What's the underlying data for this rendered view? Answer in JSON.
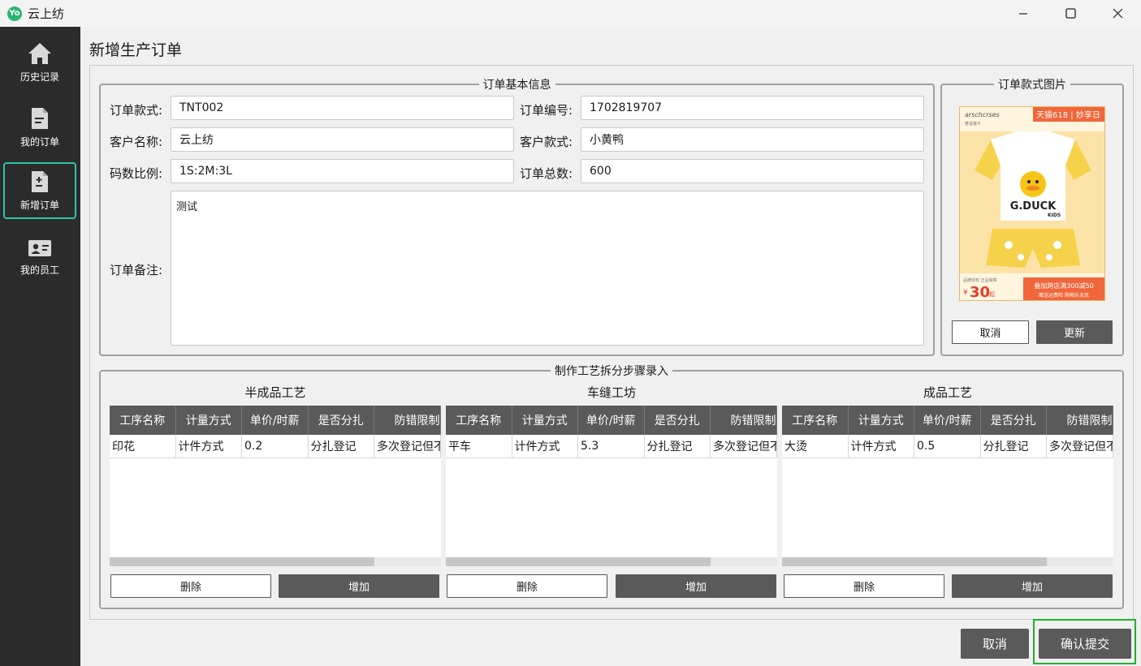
{
  "window": {
    "app_title": "云上纺",
    "logo_glyph": "Yo"
  },
  "sidebar": {
    "items": [
      {
        "label": "历史记录",
        "icon": "home-icon"
      },
      {
        "label": "我的订单",
        "icon": "document-icon"
      },
      {
        "label": "新增订单",
        "icon": "add-document-icon",
        "active": true
      },
      {
        "label": "我的员工",
        "icon": "id-card-icon"
      }
    ]
  },
  "page": {
    "title": "新增生产订单"
  },
  "basic_info": {
    "legend": "订单基本信息",
    "style_label": "订单款式:",
    "style_value": "TNT002",
    "order_no_label": "订单编号:",
    "order_no_value": "1702819707",
    "customer_label": "客户名称:",
    "customer_value": "云上纺",
    "customer_style_label": "客户款式:",
    "customer_style_value": "小黄鸭",
    "size_ratio_label": "码数比例:",
    "size_ratio_value": "1S:2M:3L",
    "total_label": "订单总数:",
    "total_value": "600",
    "remark_label": "订单备注:",
    "remark_value": "测试"
  },
  "image_box": {
    "legend": "订单款式图片",
    "cancel_label": "取消",
    "update_label": "更新",
    "image_text": {
      "brand": "arschcrses",
      "brand_sub": "奢适童®",
      "promo_tag": "天猫618 | 妙享日",
      "logo": "G.DUCK",
      "logo_sub": "KIDS",
      "price_prefix": "¥",
      "price": "30",
      "price_suffix": "起",
      "promo_line1": "叠加跨店满300减50",
      "promo_line2": "赠送运费险 购物乐无忧",
      "store_note": "品牌授权 正品保障"
    }
  },
  "process": {
    "legend": "制作工艺拆分步骤录入",
    "columns": [
      "工序名称",
      "计量方式",
      "单价/时薪",
      "是否分扎",
      "防错限制"
    ],
    "sections": [
      {
        "title": "半成品工艺",
        "rows": [
          [
            "印花",
            "计件方式",
            "0.2",
            "分扎登记",
            "多次登记但不"
          ]
        ],
        "delete_label": "删除",
        "add_label": "增加",
        "scroll_position": 0.8
      },
      {
        "title": "车缝工坊",
        "rows": [
          [
            "平车",
            "计件方式",
            "5.3",
            "分扎登记",
            "多次登记但不"
          ]
        ],
        "delete_label": "删除",
        "add_label": "增加",
        "scroll_position": 0.8
      },
      {
        "title": "成品工艺",
        "rows": [
          [
            "大烫",
            "计件方式",
            "0.5",
            "分扎登记",
            "多次登记但不"
          ]
        ],
        "delete_label": "删除",
        "add_label": "增加",
        "scroll_position": 0.8
      }
    ]
  },
  "footer": {
    "cancel_label": "取消",
    "submit_label": "确认提交"
  },
  "colors": {
    "accent": "#2fc4a8",
    "sidebar_bg": "#2b2b2b",
    "dark_button": "#5a5a5a",
    "submit_highlight": "#22b02a"
  }
}
